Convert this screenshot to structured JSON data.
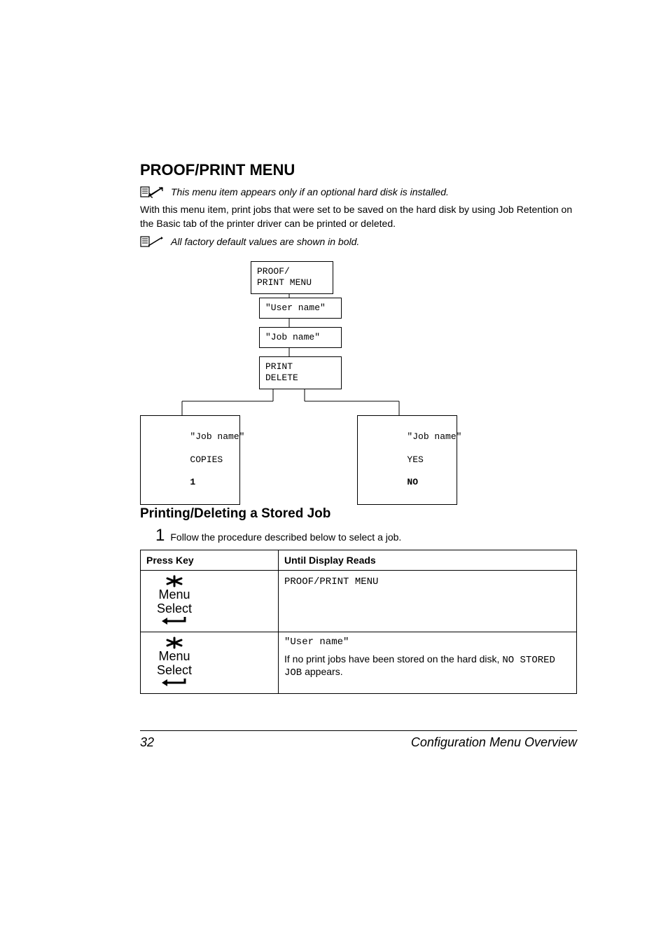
{
  "heading": "PROOF/PRINT MENU",
  "note1": "This menu item appears only if an optional hard disk is installed.",
  "body1": "With this menu item, print jobs that were set to be saved on the hard disk by using Job Retention on the Basic tab of the printer driver can be printed or deleted.",
  "note2": "All factory default values are shown in bold.",
  "tree": {
    "root": "PROOF/\nPRINT MENU",
    "user": "\"User name\"",
    "job": "\"Job name\"",
    "printdelete": "PRINT\nDELETE",
    "left_title": "\"Job name\"",
    "left_line2": "COPIES",
    "left_bold": "1",
    "right_title": "\"Job name\"",
    "right_line2": "YES",
    "right_bold": "NO"
  },
  "subheading": "Printing/Deleting a Stored Job",
  "step_num": "1",
  "step_text": "Follow the procedure described below to select a job.",
  "table": {
    "header_left": "Press Key",
    "header_right": "Until Display Reads",
    "row1": {
      "display": "PROOF/PRINT MENU"
    },
    "row2": {
      "line1": "\"User name\"",
      "line2_prefix": "If no print jobs have been stored on the hard disk, ",
      "no_stored": "NO STORED JOB",
      "appears": " appears."
    }
  },
  "footer": {
    "page": "32",
    "title": "Configuration Menu Overview"
  }
}
